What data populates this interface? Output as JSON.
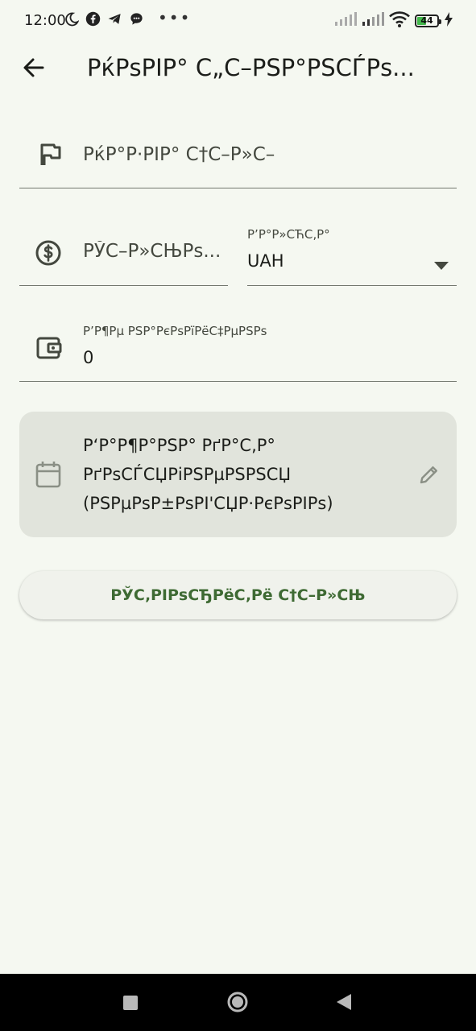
{
  "status_bar": {
    "time": "12:00",
    "battery": "44",
    "more": "•••"
  },
  "app_bar": {
    "title": "РќРѕРІР° С„С–РЅР°РЅСЃРѕ..."
  },
  "form": {
    "name_placeholder": "РќР°Р·РІР° С†С–Р»С–",
    "amount_placeholder": "РЎС–Р»СЊРѕ...",
    "currency_label": "Р’Р°Р»СЋС‚Р°",
    "currency_value": "UAH",
    "balance_label": "Р’Р¶Рµ РЅР°РєРѕРїРёС‡РµРЅРѕ",
    "balance_value": "0",
    "date_text": "Р‘Р°Р¶Р°РЅР° РґР°С‚Р° РґРѕСЃСЏРіРЅРµРЅРЅСЏ (РЅРµРѕР±РѕРІ'СЏР·РєРѕРІРѕ)"
  },
  "buttons": {
    "submit_label": "РЎС‚РІРѕСЂРёС‚Рё С†С–Р»СЊ"
  },
  "colors": {
    "background": "#f5f8f1",
    "accent": "#3e6a33",
    "card": "#e1e4dc"
  },
  "icons": [
    "moon-icon",
    "facebook-icon",
    "telegram-icon",
    "chat-icon",
    "signal-icon",
    "wifi-icon",
    "battery-icon",
    "charging-icon",
    "back-arrow-icon",
    "flag-icon",
    "dollar-icon",
    "dropdown-arrow-icon",
    "wallet-icon",
    "calendar-icon",
    "pencil-icon",
    "recents-icon",
    "home-icon",
    "back-nav-icon"
  ]
}
